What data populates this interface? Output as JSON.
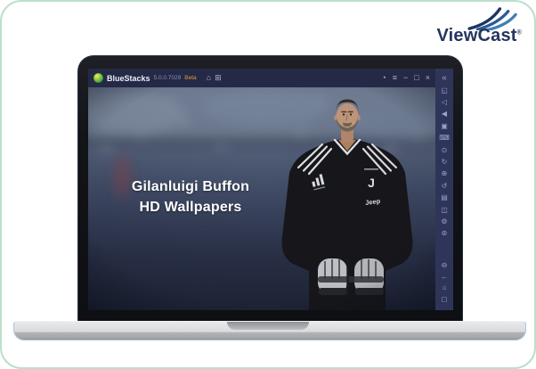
{
  "brand": {
    "name": "ViewCast",
    "registered_mark": "®"
  },
  "emulator": {
    "titlebar": {
      "app_name": "BlueStacks",
      "version": "5.0.0.7029",
      "beta_label": "Beta",
      "icons": {
        "home": "⌂",
        "multi_window": "⊞",
        "boost": "◔",
        "menu": "≡",
        "minimize": "−",
        "maximize": "□",
        "close": "×"
      }
    },
    "sidebar": {
      "collapse_icon": "«",
      "tools": [
        {
          "name": "fullscreen",
          "glyph": "◱"
        },
        {
          "name": "volume",
          "glyph": "◁"
        },
        {
          "name": "shake",
          "glyph": "◀"
        },
        {
          "name": "screenshot",
          "glyph": "▣"
        },
        {
          "name": "game-controls",
          "glyph": "⌨"
        },
        {
          "name": "macro-recorder",
          "glyph": "⊙"
        },
        {
          "name": "sync",
          "glyph": "↻"
        },
        {
          "name": "install-apk",
          "glyph": "⊕"
        },
        {
          "name": "rotate",
          "glyph": "↺"
        },
        {
          "name": "media-manager",
          "glyph": "▤"
        },
        {
          "name": "multi-instance",
          "glyph": "◫"
        },
        {
          "name": "settings",
          "glyph": "⚙"
        },
        {
          "name": "help",
          "glyph": "⊚"
        }
      ],
      "nav": [
        {
          "name": "volume-mute",
          "glyph": "⊖"
        },
        {
          "name": "back",
          "glyph": "←"
        },
        {
          "name": "home",
          "glyph": "⌂"
        },
        {
          "name": "recent-apps",
          "glyph": "◻"
        }
      ]
    },
    "app_screen": {
      "caption_line1": "Gilanluigi Buffon",
      "caption_line2": "HD Wallpapers",
      "jersey": {
        "crest_letter": "J",
        "sponsor": "Jeep"
      }
    }
  },
  "colors": {
    "border_accent": "#bcdfcb",
    "titlebar_bg": "#242946",
    "sidebar_bg": "#2f3559",
    "brand_text": "#25355e",
    "beta_text": "#e09a3e",
    "swoosh_dark": "#1c3560",
    "swoosh_mid": "#2c5d95",
    "swoosh_light": "#3e7fb5"
  }
}
